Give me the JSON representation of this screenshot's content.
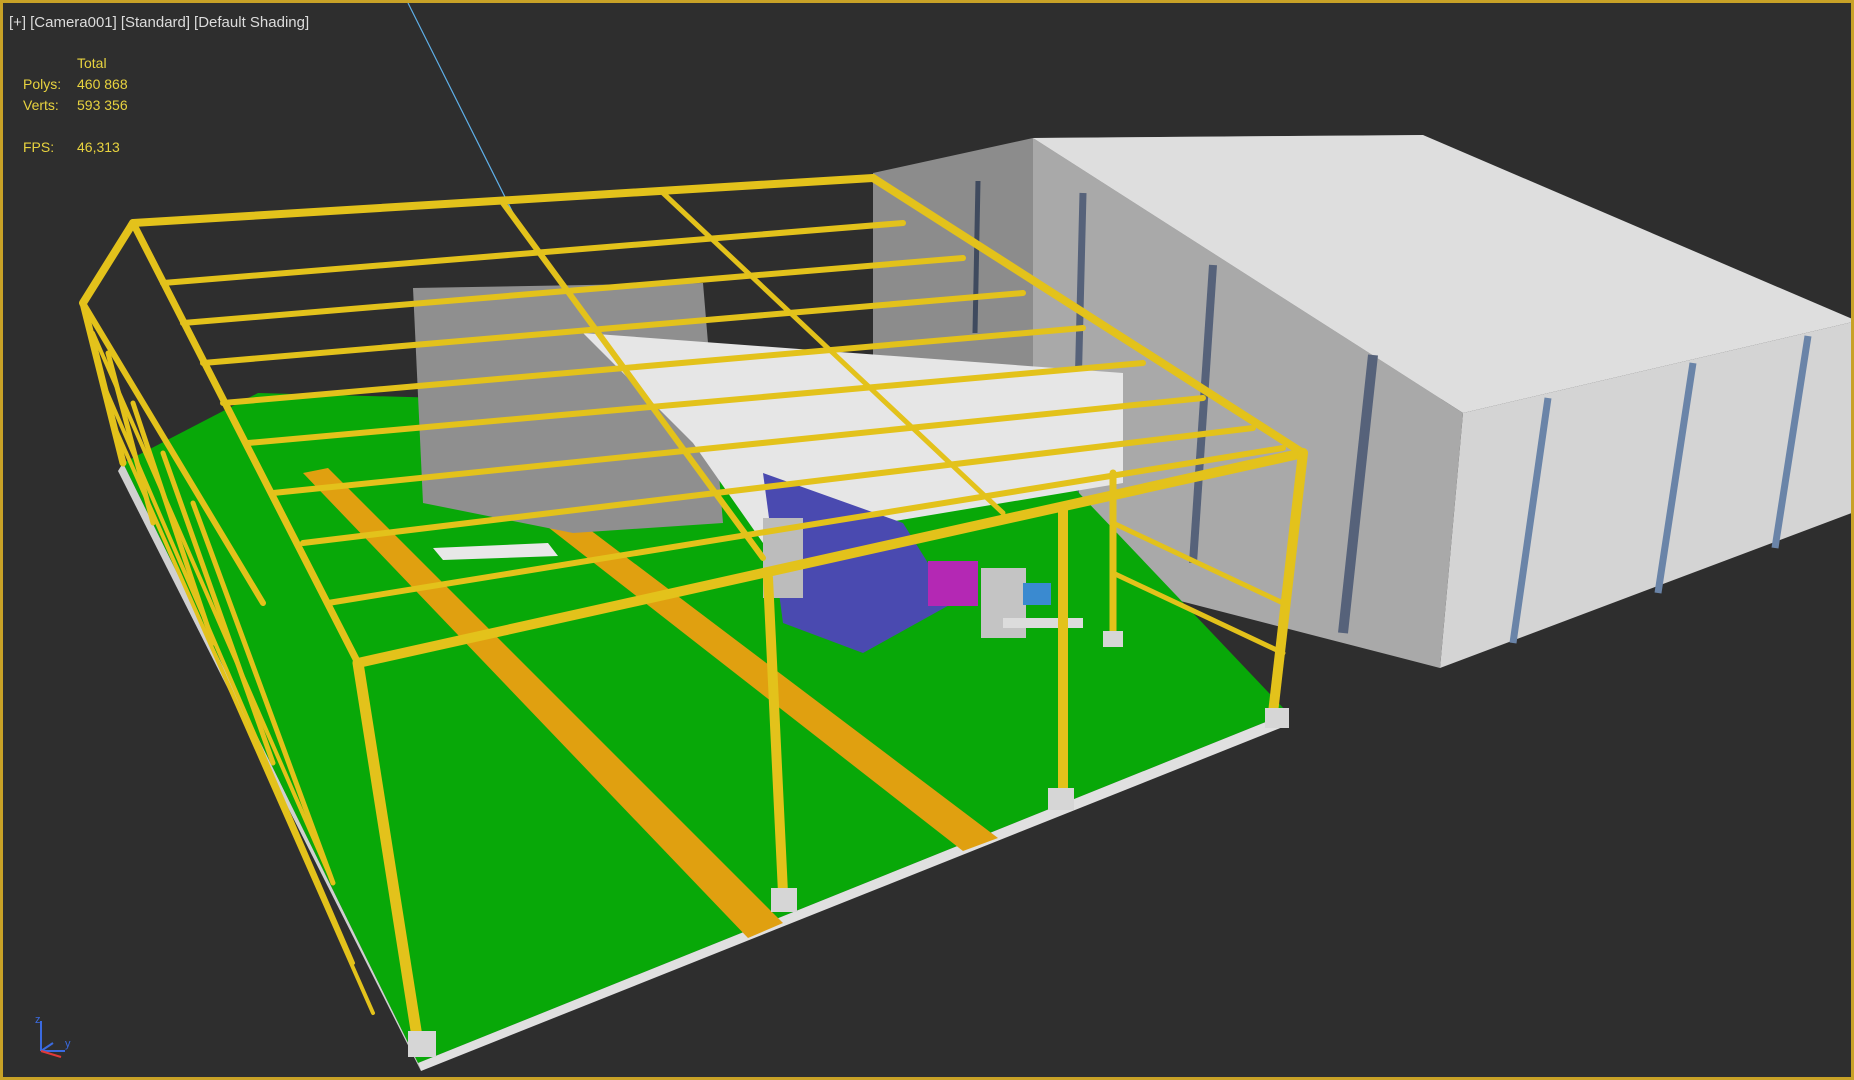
{
  "viewport": {
    "labels": [
      "[+]",
      "[Camera001]",
      "[Standard]",
      "[Default Shading]"
    ],
    "stats": {
      "header": "Total",
      "polys_label": "Polys:",
      "polys_value": "460 868",
      "verts_label": "Verts:",
      "verts_value": "593 356",
      "fps_label": "FPS:",
      "fps_value": "46,313"
    },
    "gizmo": {
      "z": "z",
      "y": "y"
    }
  },
  "colors": {
    "background": "#2e2e2e",
    "frame_yellow": "#e3c21b",
    "floor_green": "#08a808",
    "stripe_orange": "#e0a010",
    "neighbor_building": "#d8d8d8",
    "stats_text": "#e8d33f"
  }
}
